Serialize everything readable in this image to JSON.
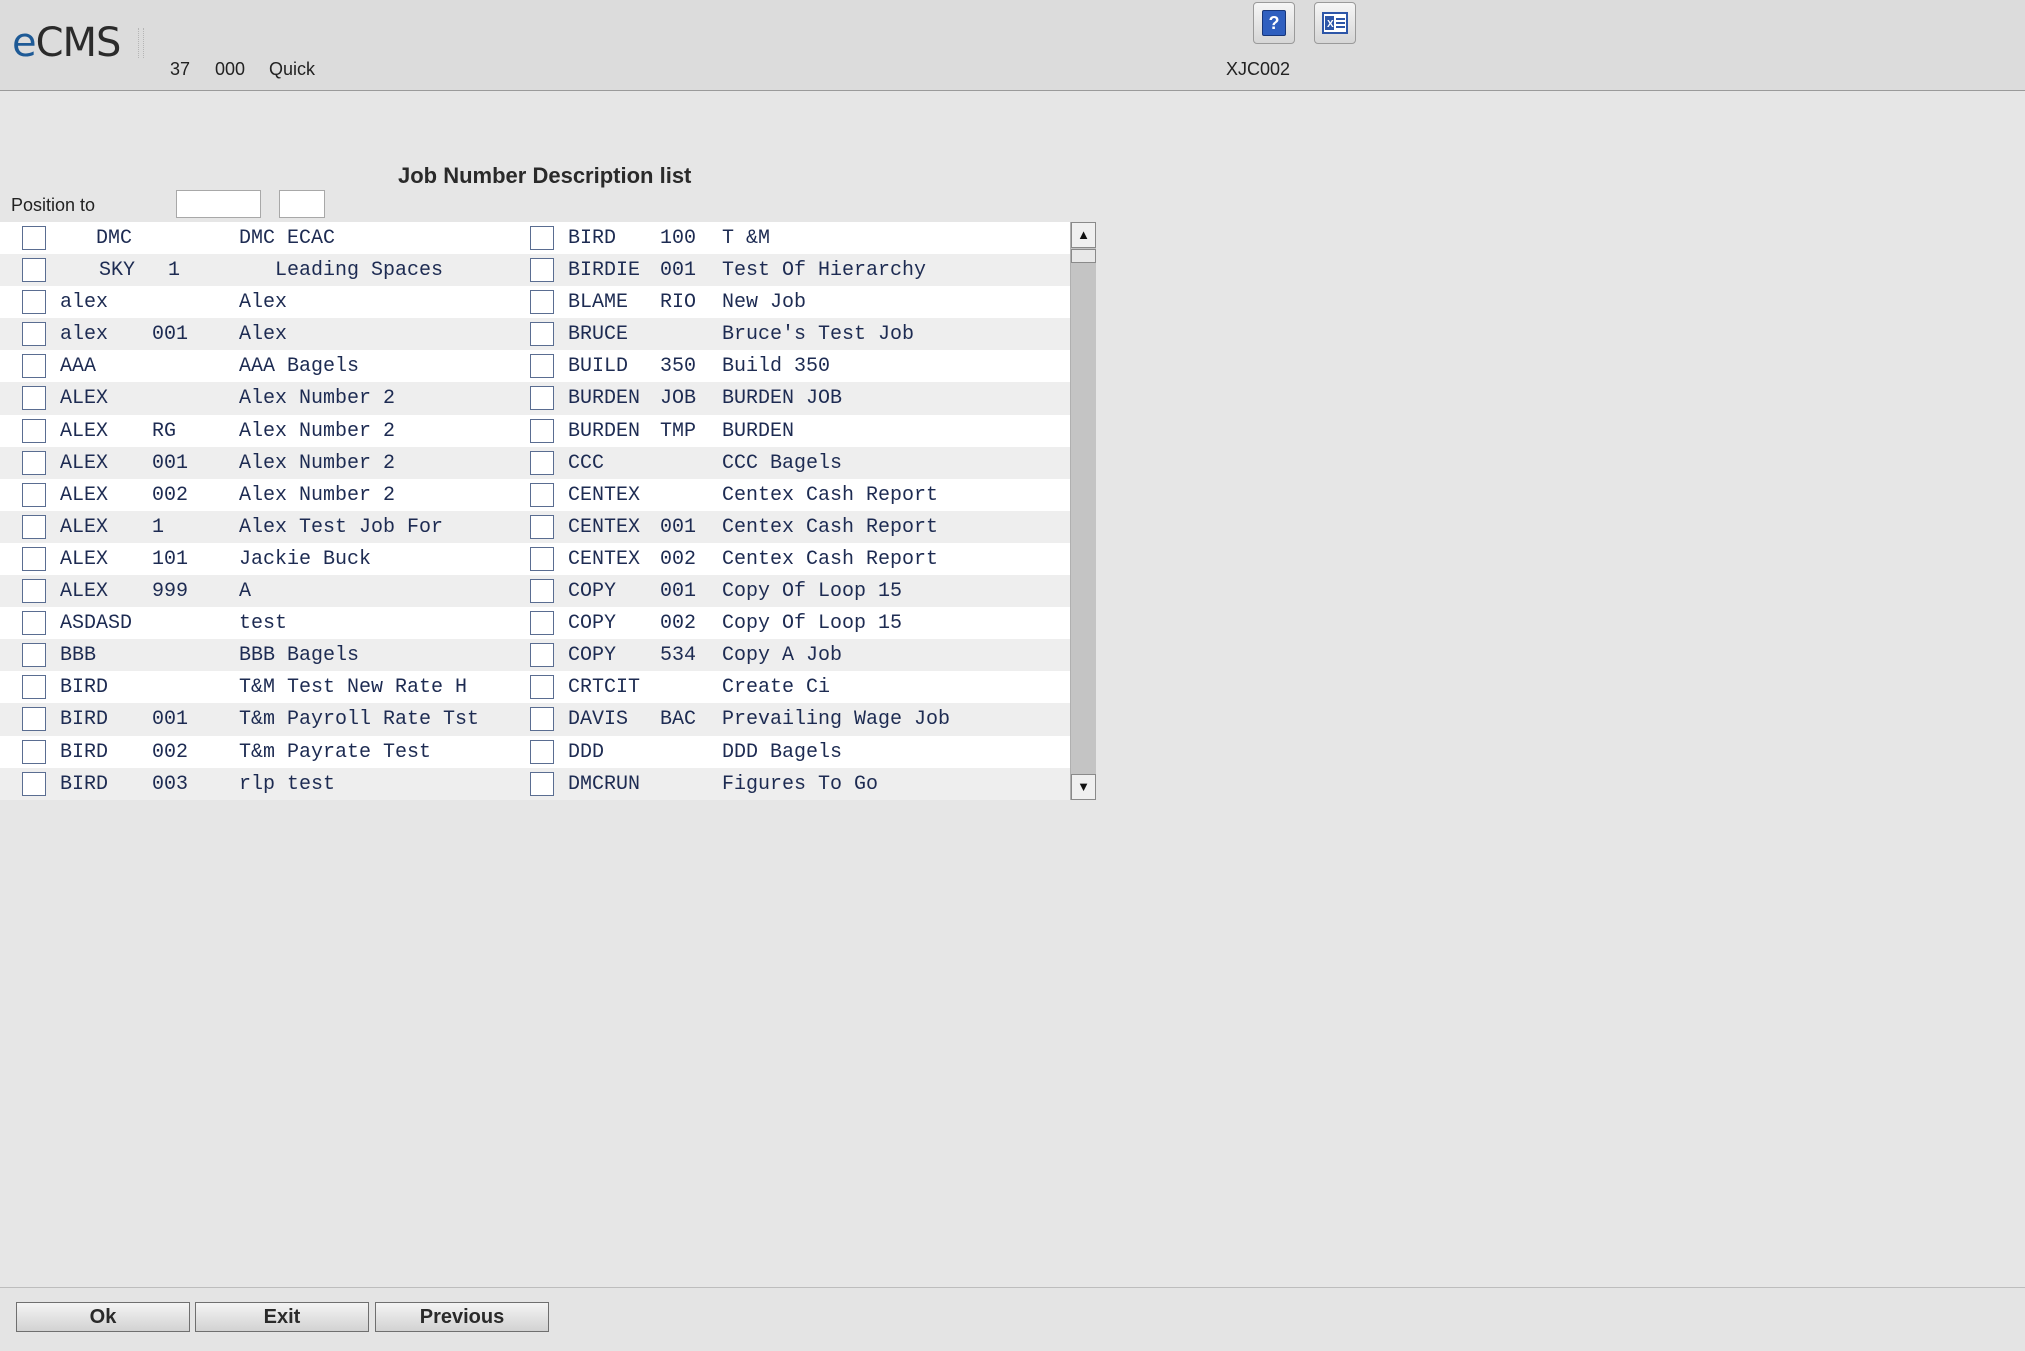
{
  "header": {
    "logo_e": "e",
    "logo_rest": "CMS",
    "company": "37",
    "division": "000",
    "mode": "Quick",
    "program_id": "XJC002",
    "help_label": "?",
    "help_icon": "help-question-icon",
    "excel_icon": "excel-export-icon"
  },
  "page": {
    "title": "Job Number Description list",
    "position_label": "Position to",
    "position_job_value": "",
    "position_sub_value": ""
  },
  "grid": {
    "left_column": [
      {
        "job": "   DMC",
        "sub": "",
        "desc": "DMC ECAC"
      },
      {
        "job": "SKY",
        "sub": "1",
        "desc": "   Leading Spaces",
        "indent": true
      },
      {
        "job": "alex",
        "sub": "",
        "desc": "Alex"
      },
      {
        "job": "alex",
        "sub": "001",
        "desc": "Alex"
      },
      {
        "job": "AAA",
        "sub": "",
        "desc": "AAA Bagels"
      },
      {
        "job": "ALEX",
        "sub": "",
        "desc": "Alex Number 2"
      },
      {
        "job": "ALEX",
        "sub": "RG",
        "desc": "Alex Number 2"
      },
      {
        "job": "ALEX",
        "sub": "001",
        "desc": "Alex Number 2"
      },
      {
        "job": "ALEX",
        "sub": "002",
        "desc": "Alex Number 2"
      },
      {
        "job": "ALEX",
        "sub": "1",
        "desc": "Alex Test Job For"
      },
      {
        "job": "ALEX",
        "sub": "101",
        "desc": "Jackie Buck"
      },
      {
        "job": "ALEX",
        "sub": "999",
        "desc": "A"
      },
      {
        "job": "ASDASD",
        "sub": "",
        "desc": "test"
      },
      {
        "job": "BBB",
        "sub": "",
        "desc": "BBB Bagels"
      },
      {
        "job": "BIRD",
        "sub": "",
        "desc": "T&M Test New Rate H"
      },
      {
        "job": "BIRD",
        "sub": "001",
        "desc": "T&m Payroll Rate Tst"
      },
      {
        "job": "BIRD",
        "sub": "002",
        "desc": "T&m Payrate Test"
      },
      {
        "job": "BIRD",
        "sub": "003",
        "desc": "rlp test"
      }
    ],
    "right_column": [
      {
        "job": "BIRD",
        "sub": "100",
        "desc": "T &M"
      },
      {
        "job": "BIRDIE",
        "sub": "001",
        "desc": "Test Of Hierarchy"
      },
      {
        "job": "BLAME",
        "sub": "RIO",
        "desc": "New Job"
      },
      {
        "job": "BRUCE",
        "sub": "",
        "desc": "Bruce's Test Job"
      },
      {
        "job": "BUILD",
        "sub": "350",
        "desc": "Build 350"
      },
      {
        "job": "BURDEN",
        "sub": "JOB",
        "desc": "BURDEN JOB"
      },
      {
        "job": "BURDEN",
        "sub": "TMP",
        "desc": "BURDEN"
      },
      {
        "job": "CCC",
        "sub": "",
        "desc": "CCC Bagels"
      },
      {
        "job": "CENTEX",
        "sub": "",
        "desc": "Centex Cash Report"
      },
      {
        "job": "CENTEX",
        "sub": "001",
        "desc": "Centex Cash Report"
      },
      {
        "job": "CENTEX",
        "sub": "002",
        "desc": "Centex Cash Report"
      },
      {
        "job": "COPY",
        "sub": "001",
        "desc": "Copy Of Loop 15"
      },
      {
        "job": "COPY",
        "sub": "002",
        "desc": "Copy Of Loop 15"
      },
      {
        "job": "COPY",
        "sub": "534",
        "desc": "Copy A Job"
      },
      {
        "job": "CRTCIT",
        "sub": "",
        "desc": "Create Ci"
      },
      {
        "job": "DAVIS",
        "sub": "BAC",
        "desc": "Prevailing Wage Job"
      },
      {
        "job": "DDD",
        "sub": "",
        "desc": "DDD Bagels"
      },
      {
        "job": "DMCRUN",
        "sub": "",
        "desc": "Figures To Go"
      }
    ]
  },
  "scrollbar": {
    "up_glyph": "▲",
    "down_glyph": "▼"
  },
  "footer": {
    "ok_label": "Ok",
    "exit_label": "Exit",
    "previous_label": "Previous"
  }
}
